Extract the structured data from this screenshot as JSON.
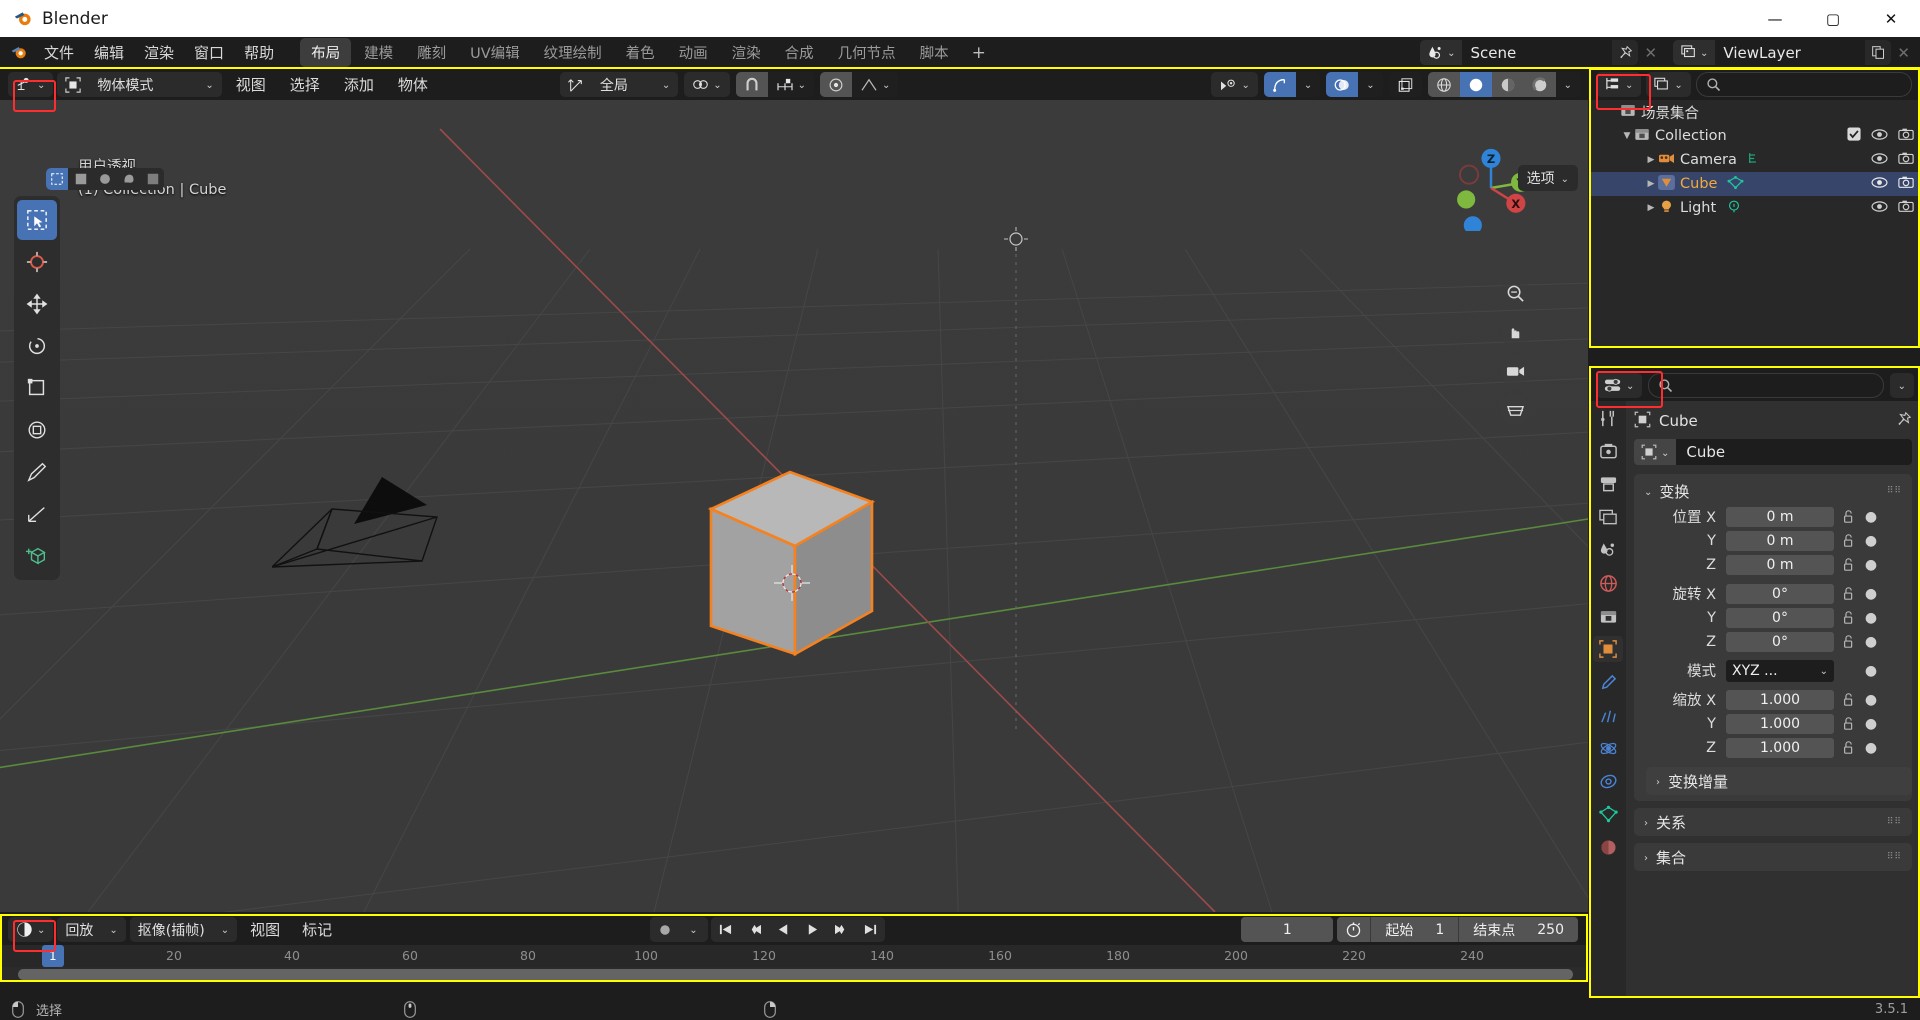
{
  "window": {
    "title": "Blender",
    "minimize": "—",
    "maximize": "▢",
    "close": "✕"
  },
  "menubar": {
    "items": [
      "文件",
      "编辑",
      "渲染",
      "窗口",
      "帮助"
    ],
    "workspaces": [
      "布局",
      "建模",
      "雕刻",
      "UV编辑",
      "纹理绘制",
      "着色",
      "动画",
      "渲染",
      "合成",
      "几何节点",
      "脚本"
    ],
    "active_workspace": "布局",
    "add_workspace": "+",
    "scene_name": "Scene",
    "view_layer_name": "ViewLayer"
  },
  "viewport": {
    "mode": "物体模式",
    "menus": [
      "视图",
      "选择",
      "添加",
      "物体"
    ],
    "transform_orientation": "全局",
    "options_label": "选项",
    "overlay_text_line1": "用户透视",
    "overlay_text_line2": "(1) Collection | Cube",
    "gizmo_axes": {
      "x": "X",
      "y": "Y",
      "z": "Z"
    }
  },
  "timeline": {
    "menus": [
      "回放",
      "抠像(插帧)",
      "视图",
      "标记"
    ],
    "current_frame": "1",
    "start_label": "起始",
    "start_value": "1",
    "end_label": "结束点",
    "end_value": "250",
    "playhead_label": "1",
    "ticks": [
      "20",
      "40",
      "60",
      "80",
      "100",
      "120",
      "140",
      "160",
      "180",
      "200",
      "220",
      "240"
    ]
  },
  "outliner": {
    "search_placeholder": "",
    "rows": [
      {
        "name": "场景集合",
        "type": "scene-collection",
        "indent": 0,
        "selected": false,
        "expanded": false,
        "has_toggle": false
      },
      {
        "name": "Collection",
        "type": "collection",
        "indent": 1,
        "selected": false,
        "expanded": true,
        "has_toggle": true
      },
      {
        "name": "Camera",
        "type": "camera",
        "indent": 2,
        "selected": false,
        "expanded": false,
        "has_toggle": false
      },
      {
        "name": "Cube",
        "type": "mesh",
        "indent": 2,
        "selected": true,
        "expanded": false,
        "has_toggle": false
      },
      {
        "name": "Light",
        "type": "light",
        "indent": 2,
        "selected": false,
        "expanded": false,
        "has_toggle": false
      }
    ]
  },
  "properties": {
    "breadcrumb_object": "Cube",
    "id_name": "Cube",
    "transform_panel": {
      "title": "变换",
      "location_label": "位置",
      "rotation_label": "旋转",
      "mode_label": "模式",
      "scale_label": "缩放",
      "axes": [
        "X",
        "Y",
        "Z"
      ],
      "location": [
        "0 m",
        "0 m",
        "0 m"
      ],
      "rotation": [
        "0°",
        "0°",
        "0°"
      ],
      "rotation_mode": "XYZ ...",
      "scale": [
        "1.000",
        "1.000",
        "1.000"
      ]
    },
    "delta_transform_label": "变换增量",
    "relations_label": "关系",
    "collections_label": "集合"
  },
  "statusbar": {
    "select_label": "选择",
    "version": "3.5.1"
  },
  "colors": {
    "accent_blue": "#4772b3",
    "highlight_yellow": "#ffff00",
    "highlight_red": "#ff2d2d",
    "orange": "#ed9e43",
    "cube_outline": "#f5811f"
  }
}
